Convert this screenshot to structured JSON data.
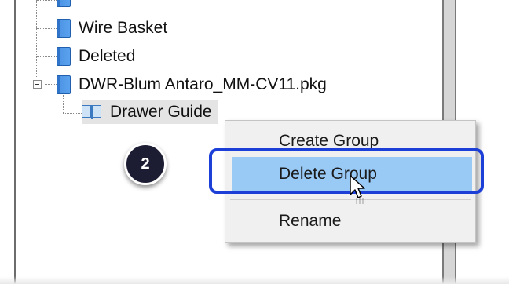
{
  "tree": {
    "items": [
      {
        "label": "Wire Basket",
        "icon": "book-icon"
      },
      {
        "label": "Deleted",
        "icon": "book-icon"
      },
      {
        "label": "DWR-Blum Antaro_MM-CV11.pkg",
        "icon": "book-icon",
        "expanded": true
      },
      {
        "label": "Drawer Guide",
        "icon": "open-book-icon",
        "selected": true
      }
    ]
  },
  "context_menu": {
    "items": [
      {
        "label": "Create Group"
      },
      {
        "label": "Delete Group",
        "highlighted": true
      },
      {
        "label": "Rename"
      }
    ]
  },
  "annotation": {
    "step": "2",
    "highlight_color": "#1c3fd8",
    "badge_color": "#1c1c33"
  },
  "colors": {
    "menu_highlight": "#99c9f5",
    "menu_background": "#f0f0f0"
  }
}
